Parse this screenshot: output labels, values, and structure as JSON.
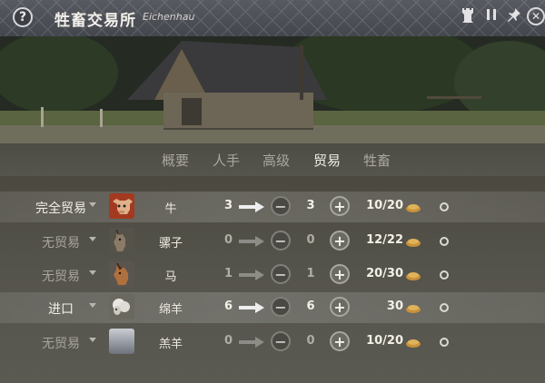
{
  "window": {
    "title": "牲畜交易所",
    "subtitle": "Eichenhau",
    "help_label": "?",
    "icons": [
      "help-icon",
      "castle-tower-icon",
      "pause-icon",
      "pin-icon",
      "close-icon"
    ]
  },
  "tabs": [
    {
      "label": "概要",
      "active": false
    },
    {
      "label": "人手",
      "active": false
    },
    {
      "label": "高级",
      "active": false
    },
    {
      "label": "贸易",
      "active": true
    },
    {
      "label": "牲畜",
      "active": false
    }
  ],
  "rows": [
    {
      "mode": "完全贸易",
      "mode_active": true,
      "animal": "牛",
      "icon": "cow-icon",
      "current": "3",
      "target": "3",
      "capacity": "10/20"
    },
    {
      "mode": "无贸易",
      "mode_active": false,
      "animal": "骡子",
      "icon": "mule-icon",
      "current": "0",
      "target": "0",
      "capacity": "12/22"
    },
    {
      "mode": "无贸易",
      "mode_active": false,
      "animal": "马",
      "icon": "horse-icon",
      "current": "1",
      "target": "1",
      "capacity": "20/30"
    },
    {
      "mode": "进口",
      "mode_active": true,
      "animal": "绵羊",
      "icon": "sheep-icon",
      "current": "6",
      "target": "6",
      "capacity": "30"
    },
    {
      "mode": "无贸易",
      "mode_active": false,
      "animal": "羔羊",
      "icon": "lamb-icon",
      "current": "0",
      "target": "0",
      "capacity": "10/20"
    }
  ],
  "controls": {
    "minus": "−",
    "plus": "+",
    "close": "✕"
  },
  "colors": {
    "accent_text": "#f2efe6",
    "dim_text": "#a7a49c",
    "titlebar": "#4e5057"
  }
}
